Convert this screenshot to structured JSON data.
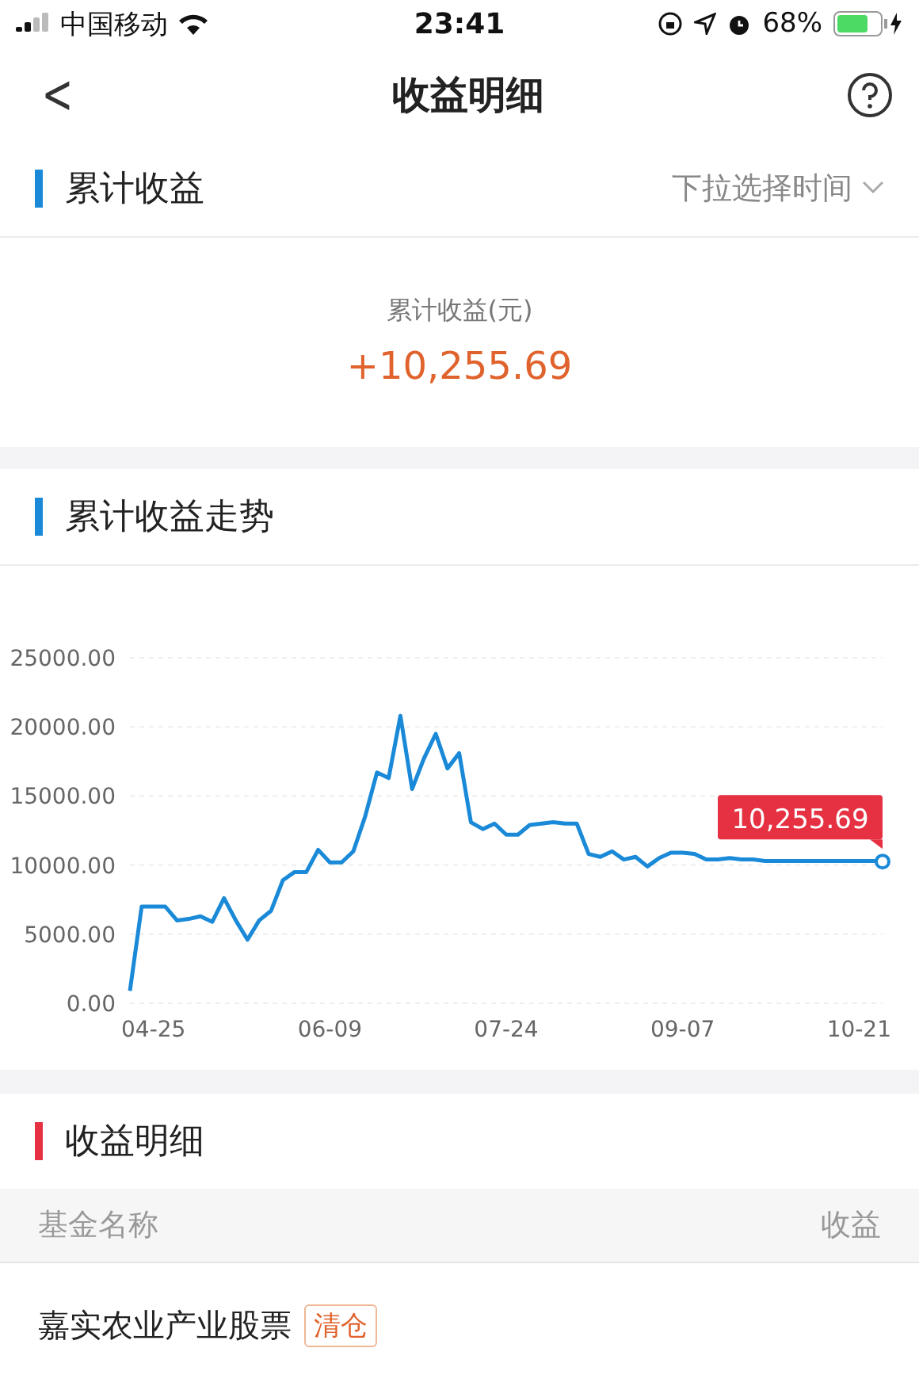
{
  "status_bar": {
    "carrier": "中国移动",
    "time": "23:41",
    "battery": "68%"
  },
  "nav": {
    "back": "<",
    "title": "收益明细"
  },
  "summary": {
    "title": "累计收益",
    "filter": "下拉选择时间",
    "label": "累计收益(元)",
    "value": "+10,255.69"
  },
  "trend": {
    "title": "累计收益走势",
    "chart_data": {
      "type": "line",
      "categories": [
        null,
        null,
        "04-25",
        null,
        null,
        null,
        null,
        null,
        null,
        null,
        null,
        null,
        null,
        null,
        null,
        null,
        null,
        "06-09",
        null,
        null,
        null,
        null,
        null,
        null,
        null,
        null,
        null,
        null,
        null,
        null,
        null,
        null,
        "07-24",
        null,
        null,
        null,
        null,
        null,
        null,
        null,
        null,
        null,
        null,
        null,
        null,
        null,
        null,
        "09-07",
        null,
        null,
        null,
        null,
        null,
        null,
        null,
        null,
        null,
        null,
        null,
        null,
        null,
        null,
        "10-21",
        null,
        null
      ],
      "series": [
        {
          "color": "#1a8ad8",
          "values": [
            900,
            7000,
            7000,
            7000,
            6000,
            6100,
            6300,
            5900,
            7600,
            6000,
            4600,
            6000,
            6700,
            8900,
            9500,
            9500,
            11100,
            10200,
            10200,
            11000,
            13500,
            16700,
            16300,
            20800,
            15500,
            17700,
            19500,
            17000,
            18100,
            13100,
            12600,
            13000,
            12200,
            12200,
            12900,
            13000,
            13100,
            13000,
            13000,
            10800,
            10600,
            11000,
            10400,
            10600,
            9900,
            10500,
            10900,
            10900,
            10800,
            10400,
            10400,
            10500,
            10400,
            10400,
            10300,
            10300,
            10300,
            10300,
            10300,
            10300,
            10300,
            10300,
            10300,
            10300,
            10300
          ]
        }
      ],
      "ylim": [
        0,
        25000
      ],
      "yticks": [
        {
          "value": 0,
          "label": "0.00"
        },
        {
          "value": 5000,
          "label": "5000.00"
        },
        {
          "value": 10000,
          "label": "10000.00"
        },
        {
          "value": 15000,
          "label": "15000.00"
        },
        {
          "value": 20000,
          "label": "20000.00"
        },
        {
          "value": 25000,
          "label": "25000.00"
        }
      ],
      "grid": true,
      "annotations": [
        {
          "y": 10255.69,
          "text": "10,255.69"
        }
      ]
    }
  },
  "details": {
    "title": "收益明细",
    "columns": [
      "基金名称",
      "收益"
    ],
    "rows": [
      {
        "name": "嘉实农业产业股票",
        "tag": "清仓"
      }
    ]
  }
}
